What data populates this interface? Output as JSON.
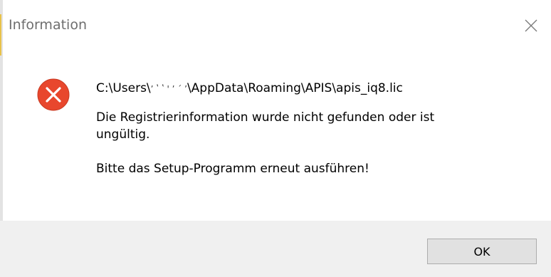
{
  "dialog": {
    "title": "Information",
    "icon": "error-icon",
    "path_text": "C:\\Users\\",
    "path_redacted": "ʼ ʽ ʽ '  ʼ ´ ’",
    "path_suffix": "\\AppData\\Roaming\\APIS\\apis_iq8.lic",
    "message_line1": "Die Registrierinformation wurde nicht gefunden oder ist",
    "message_line2": "ungültig.",
    "message_line3": "Bitte das Setup-Programm erneut ausführen!",
    "ok_label": "OK",
    "colors": {
      "error_red": "#e8472d",
      "footer_bg": "#f0f0f0",
      "button_bg": "#e1e1e1",
      "title_text": "#6e6e6e"
    }
  }
}
